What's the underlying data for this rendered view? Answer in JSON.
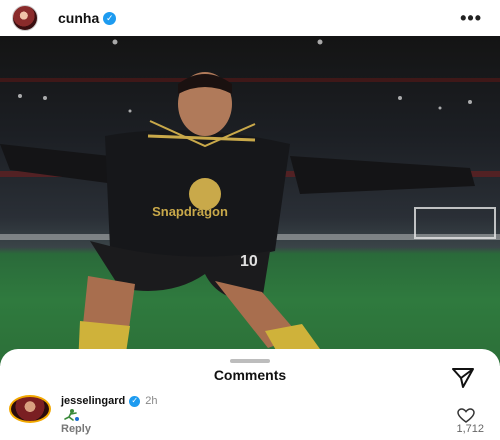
{
  "post": {
    "username": "cunha",
    "more_label": "•••",
    "avatar_icon": "user-avatar",
    "verified_icon": "verified-badge-icon",
    "image": {
      "kit_sponsor": "Snapdragon",
      "shirt_number": "10"
    }
  },
  "comments_sheet": {
    "title": "Comments",
    "share_icon": "paper-plane-icon",
    "comments": [
      {
        "username": "jesselingard",
        "time": "2h",
        "reply_label": "Reply",
        "like_count": "1,712",
        "like_icon": "heart-icon",
        "sticker_icon": "football-kick-emoji"
      }
    ]
  },
  "colors": {
    "verified_blue": "#1d9bf0",
    "story_ring": "#f2a800",
    "pitch_green": "#2f7a3e"
  }
}
